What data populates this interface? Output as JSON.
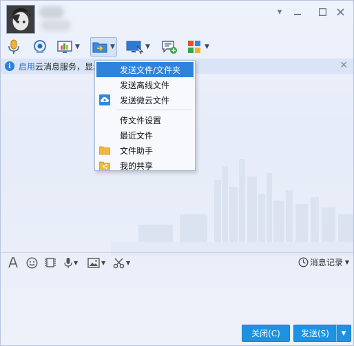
{
  "window": {
    "controls": {
      "minimize": "▾",
      "restore": "—",
      "maximize": "□",
      "close": "✕"
    }
  },
  "notice": {
    "link_text": "启用",
    "text": "云消息服务，显示",
    "close": "✕"
  },
  "menu": {
    "items": [
      {
        "label": "发送文件/文件夹",
        "icon": "",
        "selected": true
      },
      {
        "label": "发送离线文件",
        "icon": ""
      },
      {
        "label": "发送微云文件",
        "icon": "weiyun-cloud-icon"
      },
      {
        "label": "传文件设置",
        "icon": ""
      },
      {
        "label": "最近文件",
        "icon": ""
      },
      {
        "label": "文件助手",
        "icon": "folder-icon"
      },
      {
        "label": "我的共享",
        "icon": "share-folder-icon"
      }
    ]
  },
  "inputbar": {
    "history_label": "消息记录"
  },
  "buttons": {
    "close_label": "关闭(C)",
    "send_label": "发送(S)",
    "send_arrow": "▼"
  },
  "colors": {
    "accent": "#1d92e2",
    "menu_selected": "#2f83dc",
    "notice_bg": "#d9e5f7",
    "link": "#1e6fd0"
  }
}
